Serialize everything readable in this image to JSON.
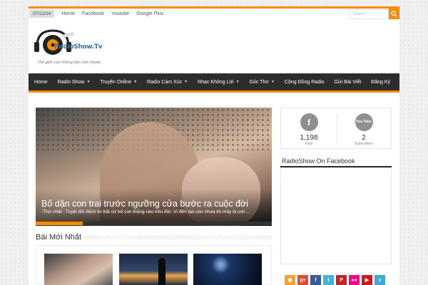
{
  "topbar": {
    "date": "07/12/14",
    "links": [
      "Home",
      "Facebook",
      "Youtube",
      "Google Plus"
    ],
    "search_placeholder": "Search"
  },
  "header": {
    "logo_text": "RadioShow.Tv",
    "tagline": "Thế giới của những tâm hồn Radio"
  },
  "nav": {
    "items": [
      {
        "label": "Home",
        "dropdown": false
      },
      {
        "label": "Radio Show",
        "dropdown": true
      },
      {
        "label": "Truyện Online",
        "dropdown": true
      },
      {
        "label": "Radio Cảm Xúc",
        "dropdown": true
      },
      {
        "label": "Nhạc Không Lời",
        "dropdown": true
      },
      {
        "label": "Góc Thơ",
        "dropdown": true
      },
      {
        "label": "Cộng Đồng Radio",
        "dropdown": false
      },
      {
        "label": "Gửi Bài Viết",
        "dropdown": false
      },
      {
        "label": "Đăng Ký",
        "dropdown": false
      }
    ]
  },
  "slider": {
    "title": "Bố dặn con trai trước ngưỡng cửa bước ra cuộc đời",
    "excerpt": "-Thứ nhất : Tuyệt đối đếch tin bất cứ bố con thằng nào trên đời.  Vì đến tao con chưa tin mấy là con ...",
    "progress": 0.2
  },
  "recent": {
    "title": "Bài Mới Nhất"
  },
  "social": {
    "facebook": {
      "icon": "f",
      "count": "1,198",
      "label": "Fans"
    },
    "youtube": {
      "icon": "You Tube",
      "count": "2",
      "label": "Subscribers"
    }
  },
  "facebook_widget": {
    "title": "RadioShow On Facebook"
  },
  "social_icons": [
    {
      "name": "rss-icon",
      "glyph": "◉",
      "color": "#f7a131"
    },
    {
      "name": "google-plus-icon",
      "glyph": "g+",
      "color": "#dd4b39"
    },
    {
      "name": "facebook-icon",
      "glyph": "f",
      "color": "#3b5998"
    },
    {
      "name": "twitter-icon",
      "glyph": "t",
      "color": "#3fb4e2"
    },
    {
      "name": "pinterest-icon",
      "glyph": "P",
      "color": "#cb2027"
    },
    {
      "name": "flickr-icon",
      "glyph": "●●",
      "color": "#ff0084"
    },
    {
      "name": "youtube-icon",
      "glyph": "▶",
      "color": "#cc181e"
    },
    {
      "name": "vimeo-icon",
      "glyph": "v",
      "color": "#3bacd4"
    }
  ]
}
